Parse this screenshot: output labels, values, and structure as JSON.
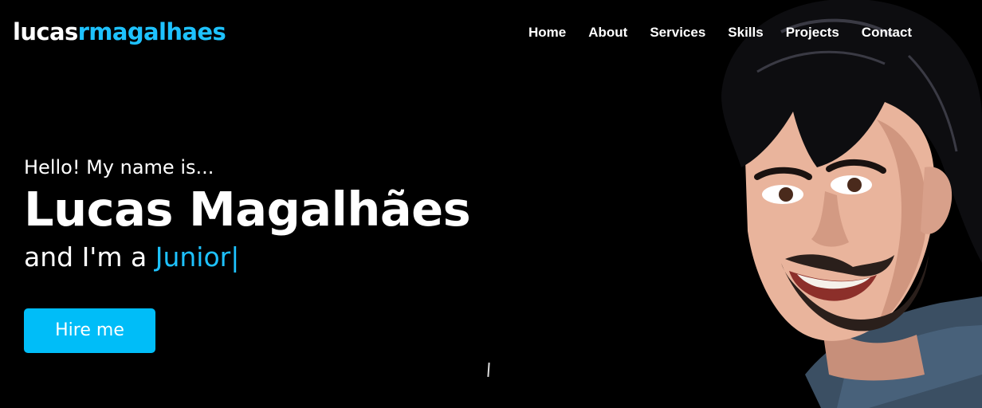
{
  "brand": {
    "logo_part1": "lucas",
    "logo_part2": "rmagalhaes"
  },
  "nav": {
    "items": [
      {
        "label": "Home"
      },
      {
        "label": "About"
      },
      {
        "label": "Services"
      },
      {
        "label": "Skills"
      },
      {
        "label": "Projects"
      },
      {
        "label": "Contact"
      }
    ]
  },
  "hero": {
    "greeting": "Hello! My name is...",
    "name": "Lucas Magalhães",
    "role_prefix": "and I'm a ",
    "role_typed": "Junior",
    "cursor": "|",
    "button_label": "Hire me"
  },
  "colors": {
    "background": "#000000",
    "accent": "#1ec2ff",
    "button": "#00bdf8",
    "text": "#ffffff"
  },
  "illustration": {
    "icon": "caricature-portrait-image"
  }
}
